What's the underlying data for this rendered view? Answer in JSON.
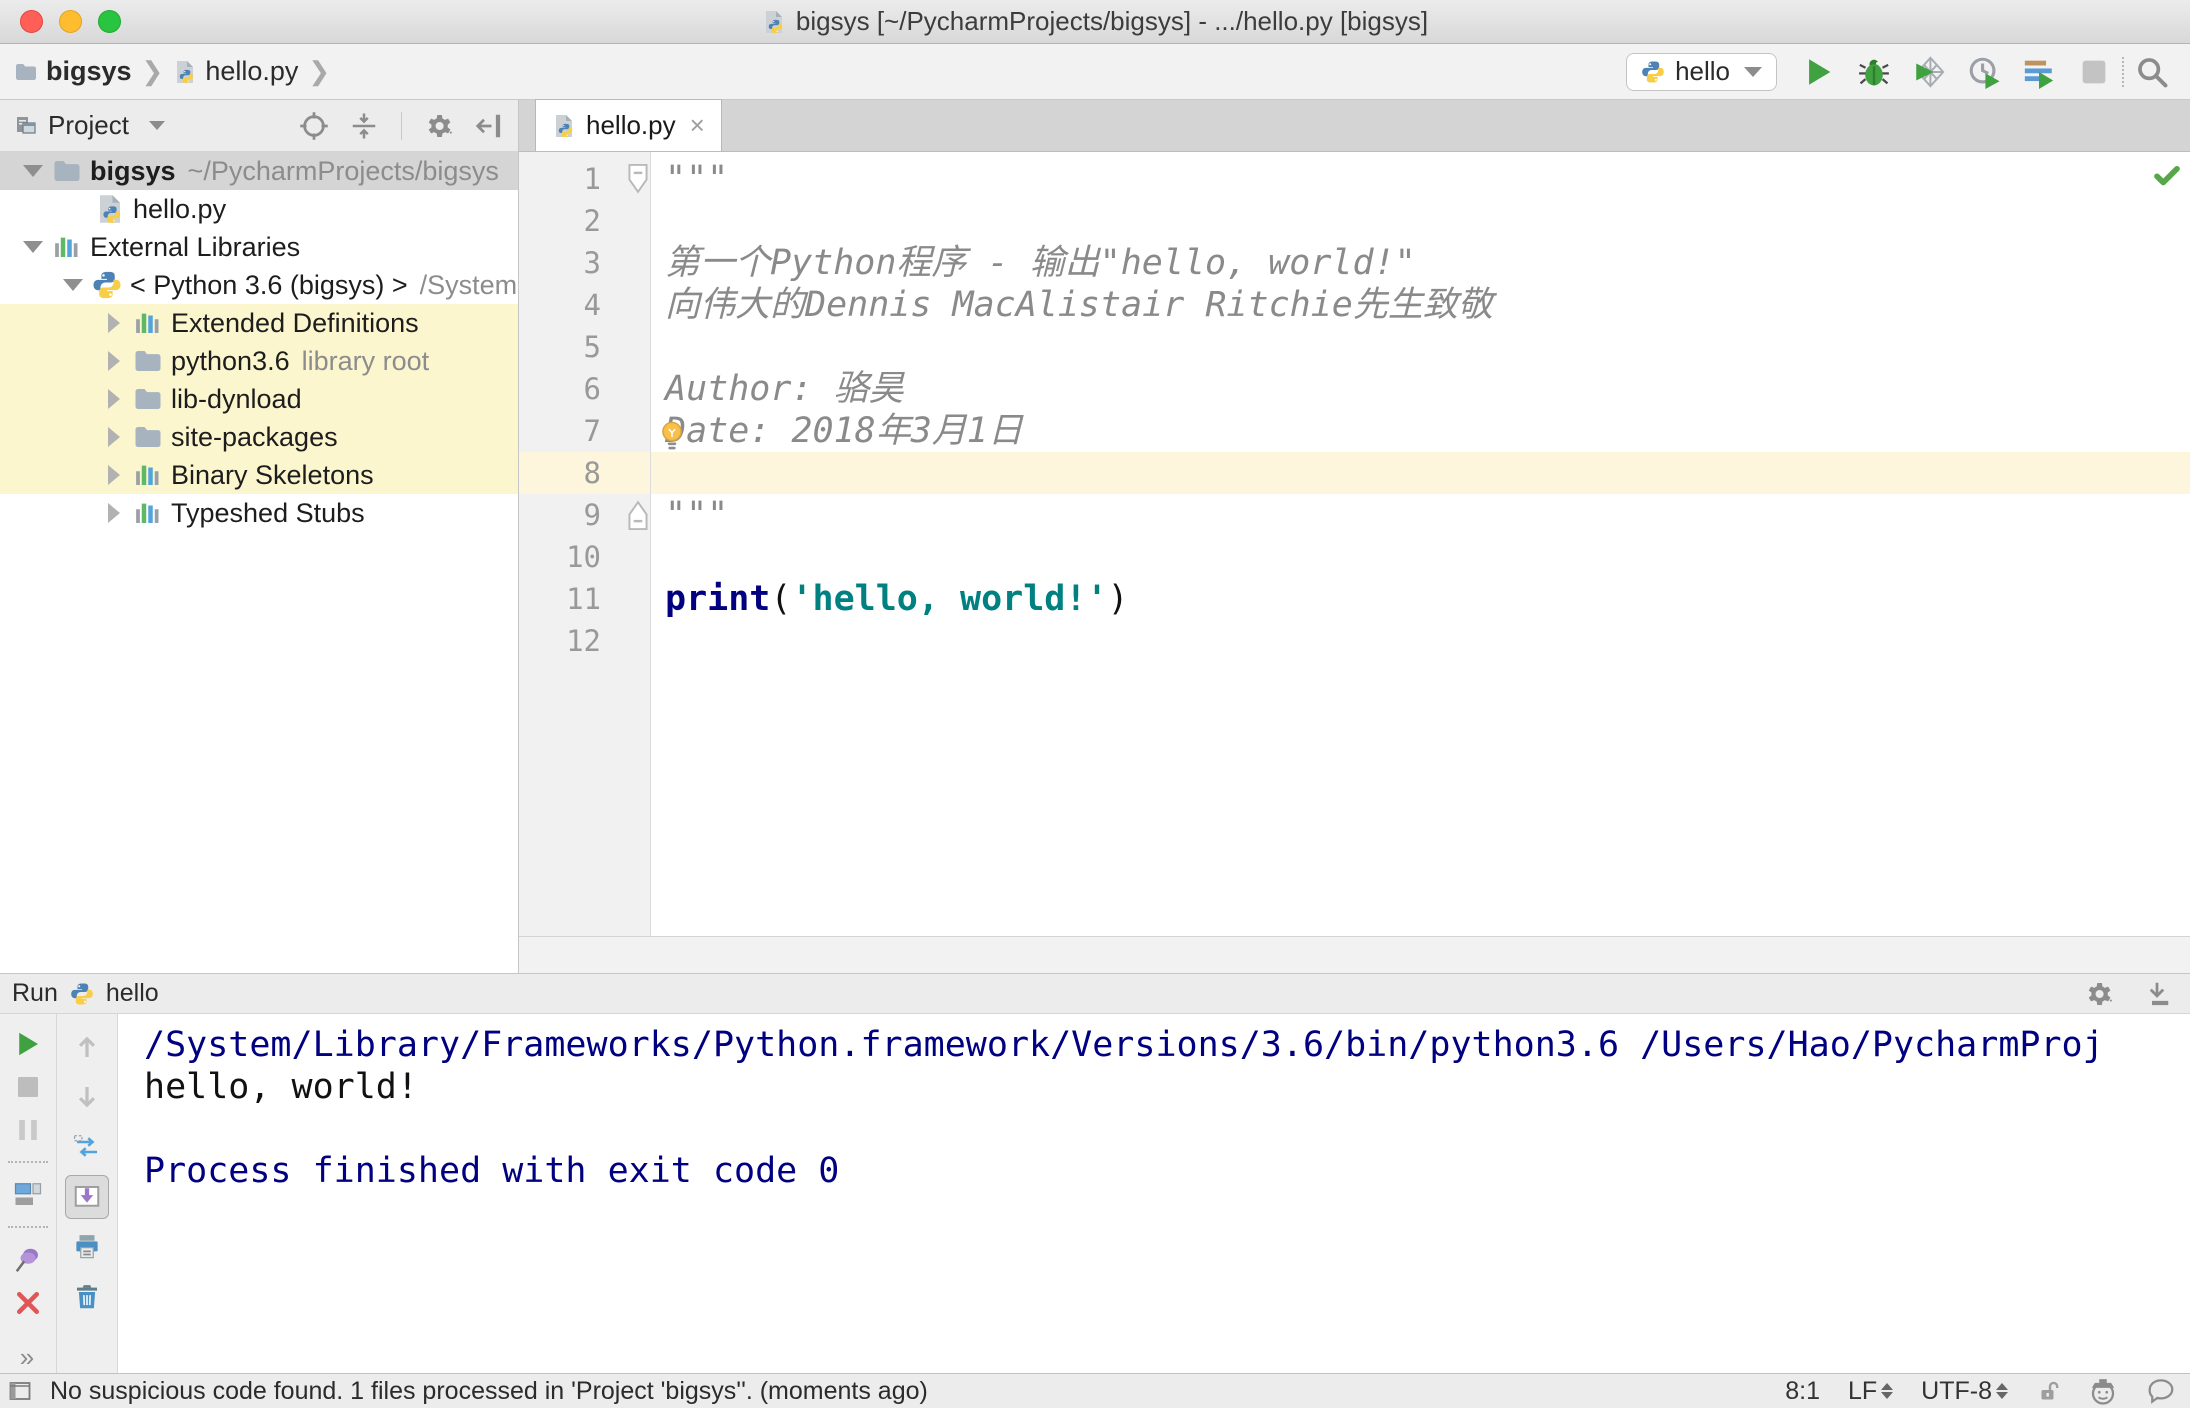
{
  "colors": {
    "keyword": "#000080",
    "string": "#008080",
    "doc": "#8a8a8a",
    "console_system": "#000080",
    "caret_row": "#fdf6dd",
    "tree_highlight": "#fbf6ce",
    "selection": "#d5d5d5",
    "run_green": "#3fa13f"
  },
  "window": {
    "title": "bigsys [~/PycharmProjects/bigsys] - .../hello.py [bigsys]"
  },
  "toolbar": {
    "breadcrumbs": [
      {
        "label": "bigsys",
        "icon": "folder"
      },
      {
        "label": "hello.py",
        "icon": "python-file"
      }
    ],
    "run_config": "hello",
    "actions": [
      "run",
      "debug",
      "coverage",
      "profiler",
      "concurrency",
      "stop"
    ]
  },
  "project_panel": {
    "title": "Project",
    "header_actions": [
      "locate",
      "collapse-all",
      "sep",
      "gear",
      "hide-left"
    ],
    "tree": [
      {
        "label": "bigsys",
        "hint": "~/PycharmProjects/bigsys",
        "icon": "folder",
        "expander": "open",
        "indent": 0,
        "bold": true,
        "selected": true
      },
      {
        "label": "hello.py",
        "hint": "",
        "icon": "python-file",
        "expander": "none",
        "indent": 2,
        "bold": false,
        "selected": false
      },
      {
        "label": "External Libraries",
        "hint": "",
        "icon": "library",
        "expander": "open",
        "indent": 0,
        "bold": false,
        "selected": false
      },
      {
        "label": "< Python 3.6 (bigsys) >",
        "hint": "/System",
        "icon": "python",
        "expander": "open",
        "indent": 1,
        "bold": false,
        "selected": false
      },
      {
        "label": "Extended Definitions",
        "hint": "",
        "icon": "library",
        "expander": "closed",
        "indent": 2,
        "bold": false,
        "selected": false,
        "highlight": true
      },
      {
        "label": "python3.6",
        "hint": "library root",
        "icon": "folder",
        "expander": "closed",
        "indent": 2,
        "bold": false,
        "selected": false,
        "highlight": true
      },
      {
        "label": "lib-dynload",
        "hint": "",
        "icon": "folder",
        "expander": "closed",
        "indent": 2,
        "bold": false,
        "selected": false,
        "highlight": true
      },
      {
        "label": "site-packages",
        "hint": "",
        "icon": "folder",
        "expander": "closed",
        "indent": 2,
        "bold": false,
        "selected": false,
        "highlight": true
      },
      {
        "label": "Binary Skeletons",
        "hint": "",
        "icon": "library",
        "expander": "closed",
        "indent": 2,
        "bold": false,
        "selected": false,
        "highlight": true
      },
      {
        "label": "Typeshed Stubs",
        "hint": "",
        "icon": "library",
        "expander": "closed",
        "indent": 2,
        "bold": false,
        "selected": false,
        "highlight": false
      }
    ]
  },
  "editor": {
    "tab": "hello.py",
    "lines": [
      {
        "num": 1,
        "fold": "start",
        "tokens": [
          {
            "t": "\"\"\"",
            "c": "doc"
          }
        ]
      },
      {
        "num": 2,
        "tokens": []
      },
      {
        "num": 3,
        "tokens": [
          {
            "t": "第一个Python程序 - 输出\"hello, world!\"",
            "c": "doc"
          }
        ]
      },
      {
        "num": 4,
        "tokens": [
          {
            "t": "向伟大的Dennis MacAlistair Ritchie先生致敬",
            "c": "doc"
          }
        ]
      },
      {
        "num": 5,
        "tokens": []
      },
      {
        "num": 6,
        "tokens": [
          {
            "t": "Author: 骆昊",
            "c": "doc"
          }
        ]
      },
      {
        "num": 7,
        "bulb": true,
        "tokens": [
          {
            "t": "Date: 2018年3月1日",
            "c": "doc"
          }
        ]
      },
      {
        "num": 8,
        "caret": true,
        "tokens": []
      },
      {
        "num": 9,
        "fold": "end",
        "tokens": [
          {
            "t": "\"\"\"",
            "c": "doc"
          }
        ]
      },
      {
        "num": 10,
        "tokens": []
      },
      {
        "num": 11,
        "tokens": [
          {
            "t": "print",
            "c": "kw"
          },
          {
            "t": "(",
            "c": "plain"
          },
          {
            "t": "'hello, world!'",
            "c": "str"
          },
          {
            "t": ")",
            "c": "plain"
          }
        ]
      },
      {
        "num": 12,
        "tokens": []
      }
    ]
  },
  "run_panel": {
    "title": "Run",
    "config": "hello",
    "header_actions": [
      "gear",
      "hide-down"
    ],
    "toolbar_main": [
      "rerun",
      "stop-square",
      "pause",
      "sep",
      "layout",
      "sep",
      "pin",
      "close-red",
      "more"
    ],
    "toolbar_side": [
      "up-arrow",
      "down-arrow",
      "restore-layout",
      "scroll-end",
      "print",
      "clear"
    ],
    "console": [
      {
        "text": "/System/Library/Frameworks/Python.framework/Versions/3.6/bin/python3.6 /Users/Hao/PycharmProj",
        "c": "system"
      },
      {
        "text": "hello, world!",
        "c": "stdout"
      },
      {
        "text": "",
        "c": "stdout"
      },
      {
        "text": "Process finished with exit code 0",
        "c": "system"
      }
    ]
  },
  "status_bar": {
    "message": "No suspicious code found. 1 files processed in 'Project 'bigsys''. (moments ago)",
    "position": "8:1",
    "line_ending": "LF",
    "encoding": "UTF-8"
  }
}
